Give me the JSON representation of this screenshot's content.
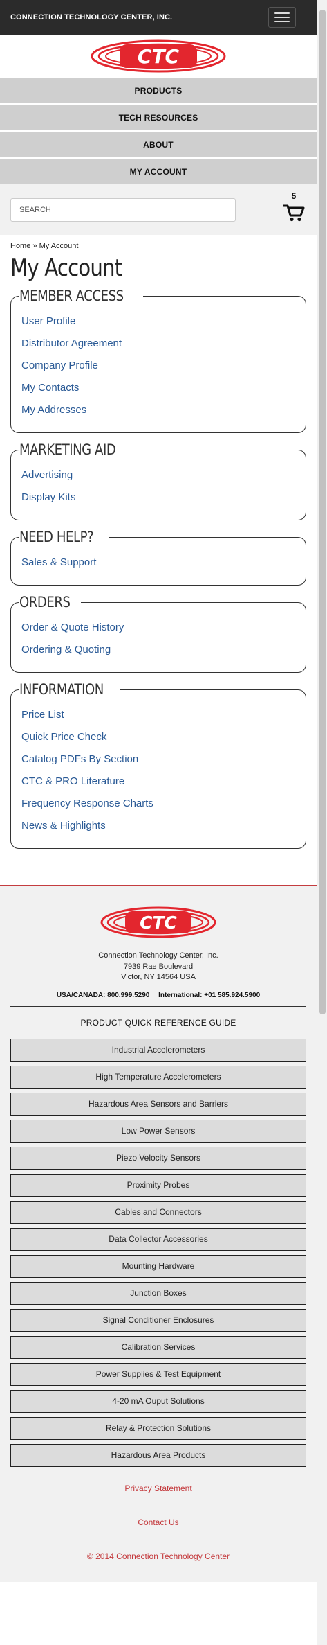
{
  "header": {
    "brand_name": "CONNECTION TECHNOLOGY CENTER, INC.",
    "logo_text": "CTC",
    "menu_icon": "hamburger-icon"
  },
  "nav": {
    "items": [
      "PRODUCTS",
      "TECH RESOURCES",
      "ABOUT",
      "MY ACCOUNT"
    ]
  },
  "search": {
    "placeholder": "SEARCH"
  },
  "cart": {
    "count": "5",
    "icon": "cart-icon"
  },
  "breadcrumb": {
    "home": "Home",
    "separator": " » ",
    "current": "My Account"
  },
  "page_title": "My Account",
  "panels": [
    {
      "title": "MEMBER ACCESS",
      "links": [
        "User Profile",
        "Distributor Agreement",
        "Company Profile",
        "My Contacts",
        "My Addresses"
      ]
    },
    {
      "title": "MARKETING AID",
      "links": [
        "Advertising",
        "Display Kits"
      ]
    },
    {
      "title": "NEED HELP?",
      "links": [
        "Sales & Support"
      ]
    },
    {
      "title": "ORDERS",
      "links": [
        "Order & Quote History",
        "Ordering & Quoting"
      ]
    },
    {
      "title": "INFORMATION",
      "links": [
        "Price List",
        "Quick Price Check",
        "Catalog PDFs By Section",
        "CTC & PRO Literature",
        "Frequency Response Charts",
        "News & Highlights"
      ]
    }
  ],
  "footer": {
    "address": {
      "company": "Connection Technology Center, Inc.",
      "street": "7939 Rae Boulevard",
      "city": "Victor, NY 14564 USA"
    },
    "phone_us": "USA/CANADA: 800.999.5290",
    "phone_intl": "International: +01 585.924.5900",
    "guide_title": "PRODUCT QUICK REFERENCE GUIDE",
    "products": [
      "Industrial Accelerometers",
      "High Temperature Accelerometers",
      "Hazardous Area Sensors and Barriers",
      "Low Power Sensors",
      "Piezo Velocity Sensors",
      "Proximity Probes",
      "Cables and Connectors",
      "Data Collector Accessories",
      "Mounting Hardware",
      "Junction Boxes",
      "Signal Conditioner Enclosures",
      "Calibration Services",
      "Power Supplies & Test Equipment",
      "4-20 mA Ouput Solutions",
      "Relay & Protection Solutions",
      "Hazardous Area Products"
    ],
    "privacy": "Privacy Statement",
    "contact": "Contact Us",
    "copyright": "© 2014 Connection Technology Center"
  },
  "colors": {
    "brand_red": "#e3262e",
    "link_blue": "#2a5a96",
    "footer_link_red": "#c4393c",
    "topbar": "#2b2b2b",
    "nav_gray": "#cfcfcf"
  }
}
